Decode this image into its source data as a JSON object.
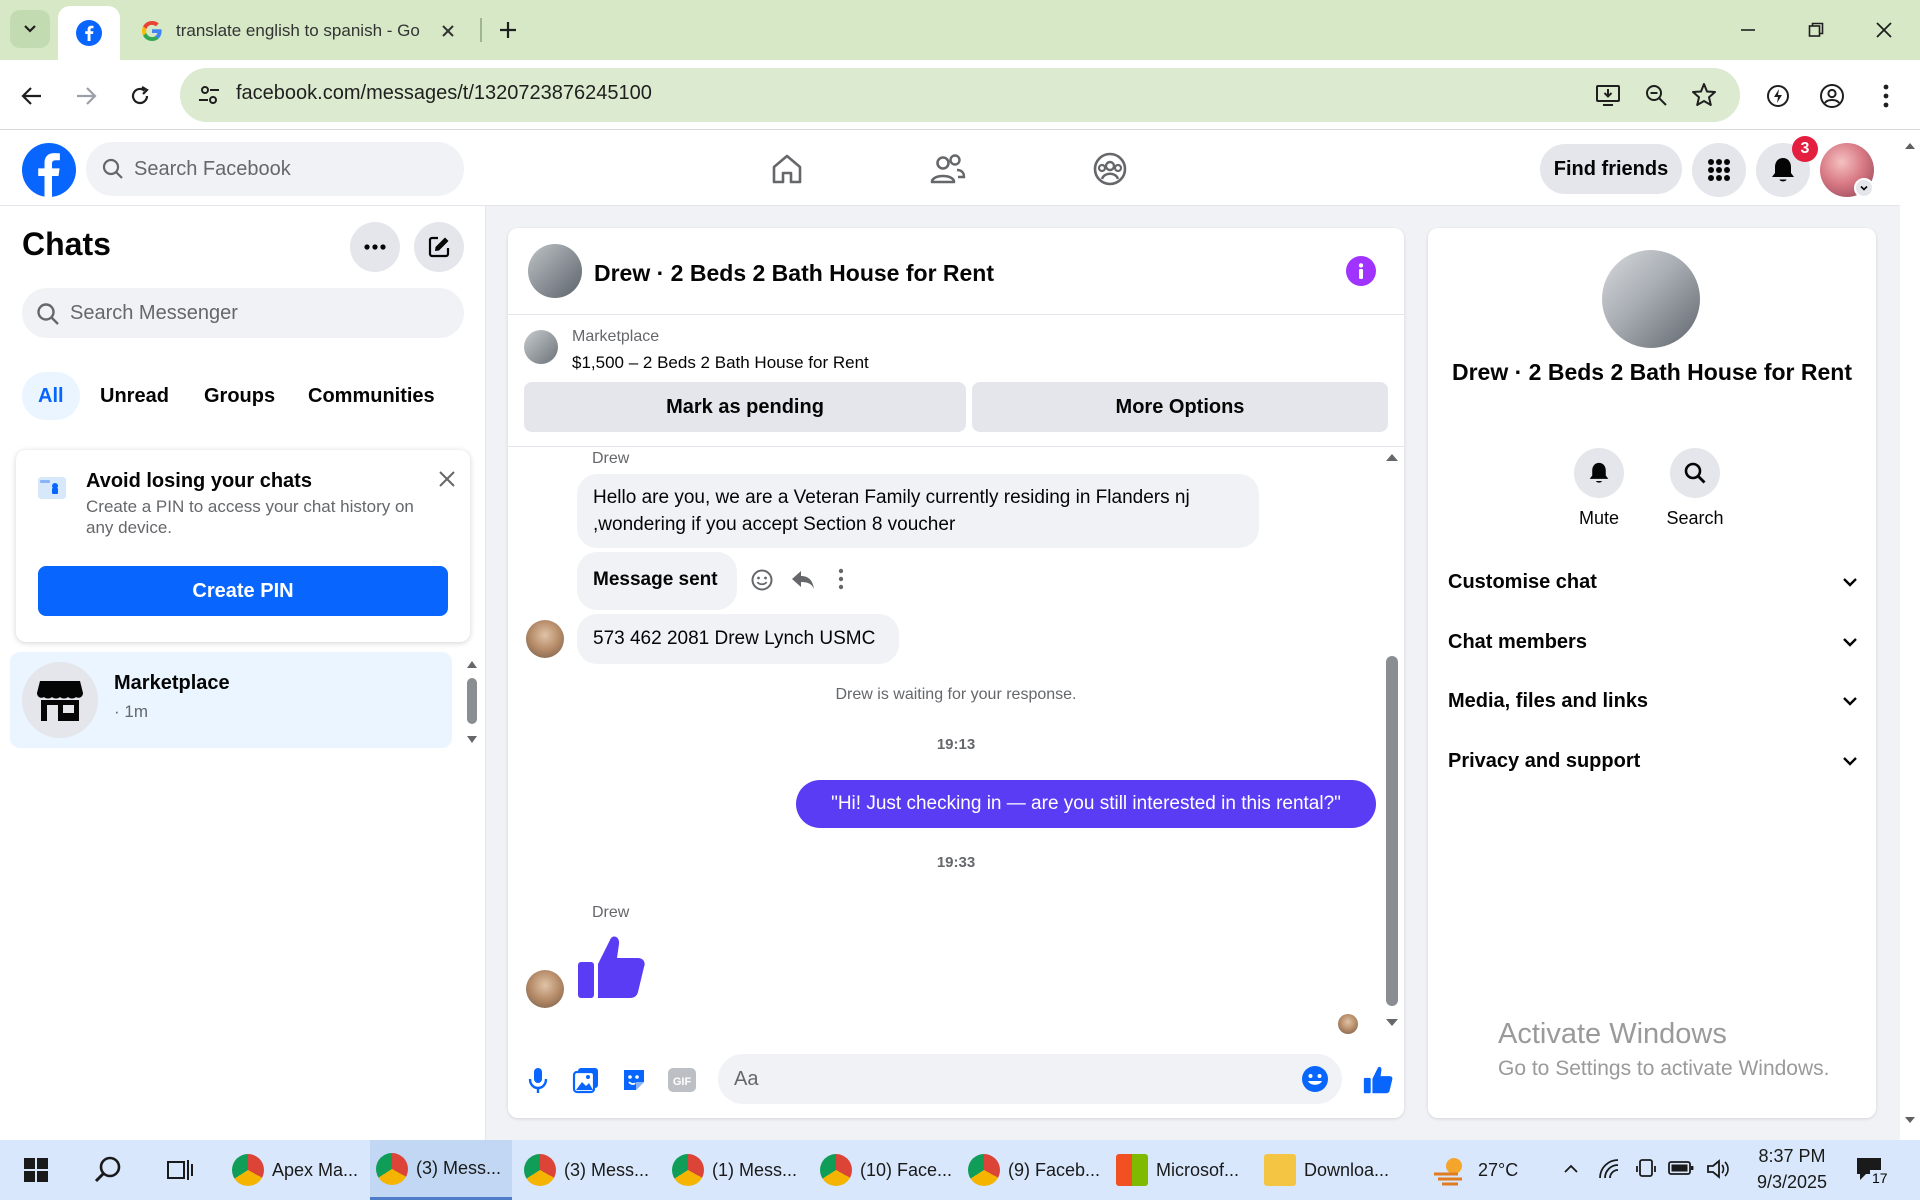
{
  "browser": {
    "tabs": [
      {
        "title": "",
        "icon": "facebook-icon",
        "active": true
      },
      {
        "title": "translate english to spanish - Go",
        "icon": "google-icon",
        "active": false
      }
    ],
    "url": "facebook.com/messages/t/1320723876245100"
  },
  "fb_header": {
    "search_placeholder": "Search Facebook",
    "find_friends": "Find friends",
    "notification_count": "3"
  },
  "left": {
    "title": "Chats",
    "search_placeholder": "Search Messenger",
    "filters": [
      "All",
      "Unread",
      "Groups",
      "Communities"
    ],
    "pin_card": {
      "title": "Avoid losing your chats",
      "desc": "Create a PIN to access your chat history on any device.",
      "button": "Create PIN"
    },
    "chat_item": {
      "name": "Marketplace",
      "meta": "· 1m"
    }
  },
  "conversation": {
    "title": "Drew · 2 Beds 2 Bath House for Rent",
    "marketplace_label": "Marketplace",
    "listing": "$1,500 – 2 Beds 2 Bath House for Rent",
    "btn_pending": "Mark as pending",
    "btn_more": "More Options",
    "messages": {
      "sender1": "Drew",
      "msg1_line1": "Hello are you, we are a Veteran  Family currently residing in Flanders nj",
      "msg1_line2": ",wondering if you accept Section 8 voucher",
      "msg2": "Message sent",
      "msg3": "573 462 2081 Drew Lynch USMC",
      "waiting": "Drew is waiting for your response.",
      "time1": "19:13",
      "outgoing": "\"Hi! Just checking in — are you still interested in this rental?\"",
      "time2": "19:33",
      "sender2": "Drew"
    },
    "composer_placeholder": "Aa"
  },
  "info_panel": {
    "name": "Drew · 2 Beds 2 Bath House for Rent",
    "actions": [
      "Mute",
      "Search"
    ],
    "sections": [
      "Customise chat",
      "Chat members",
      "Media, files and links",
      "Privacy and support"
    ]
  },
  "watermark": {
    "line1": "Activate Windows",
    "line2": "Go to Settings to activate Windows."
  },
  "taskbar": {
    "apps": [
      "Apex Ma...",
      "(3) Mess...",
      "(3) Mess...",
      "(1) Mess...",
      "(10) Face...",
      "(9) Faceb...",
      "Microsof...",
      "Downloa..."
    ],
    "temperature": "27°C",
    "time": "8:37 PM",
    "date": "9/3/2025",
    "notification_count": "17"
  },
  "colors": {
    "fb_blue": "#0866ff",
    "outgoing_bubble": "#5b3cf5",
    "info_purple": "#a033ff",
    "badge_red": "#e41e3f"
  }
}
